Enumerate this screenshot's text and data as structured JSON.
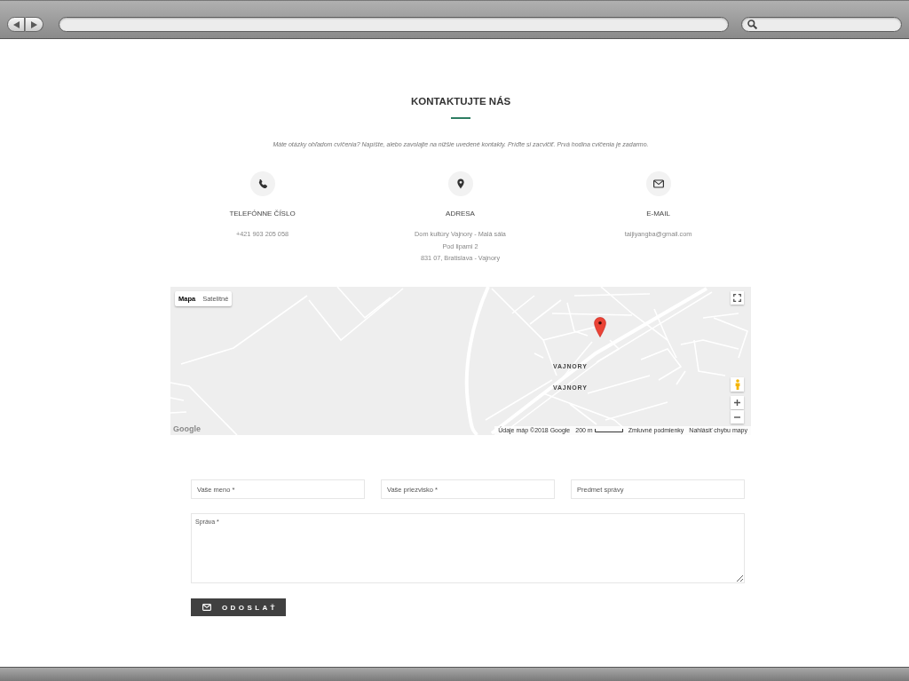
{
  "section": {
    "title": "KONTAKTUJTE NÁS",
    "intro": "Máte otázky ohľadom cvičenia? Napíšte, alebo zavolajte na nižšie uvedené kontakty. Príďte si zacvičiť. Prvá hodina cvičenia je zadarmo."
  },
  "contacts": [
    {
      "kind": "phone",
      "label": "TELEFÓNNE ČÍSLO",
      "lines": [
        "+421 903 205 058"
      ]
    },
    {
      "kind": "address",
      "label": "ADRESA",
      "lines": [
        "Dom kultúry Vajnory - Malá sála",
        "Pod lipami 2",
        "831 07, Bratislava - Vajnory"
      ]
    },
    {
      "kind": "email",
      "label": "E-MAIL",
      "lines": [
        "taijiyangba@gmail.com"
      ]
    }
  ],
  "map": {
    "map_types": [
      {
        "label": "Mapa",
        "selected": true
      },
      {
        "label": "Satelitné",
        "selected": false
      }
    ],
    "place_labels": [
      "VAJNORY",
      "VAJNORY"
    ],
    "logo": "Google",
    "attribution": "Údaje máp ©2018 Google",
    "scale": "200 m",
    "terms": "Zmluvné podmienky",
    "report": "Nahlásiť chybu mapy"
  },
  "form": {
    "fields": [
      {
        "placeholder": "Vaše meno *"
      },
      {
        "placeholder": "Vaše priezvisko *"
      },
      {
        "placeholder": "Predmet správy"
      }
    ],
    "message": {
      "placeholder": "Správa *"
    },
    "submit": "ODOSLAŤ"
  }
}
